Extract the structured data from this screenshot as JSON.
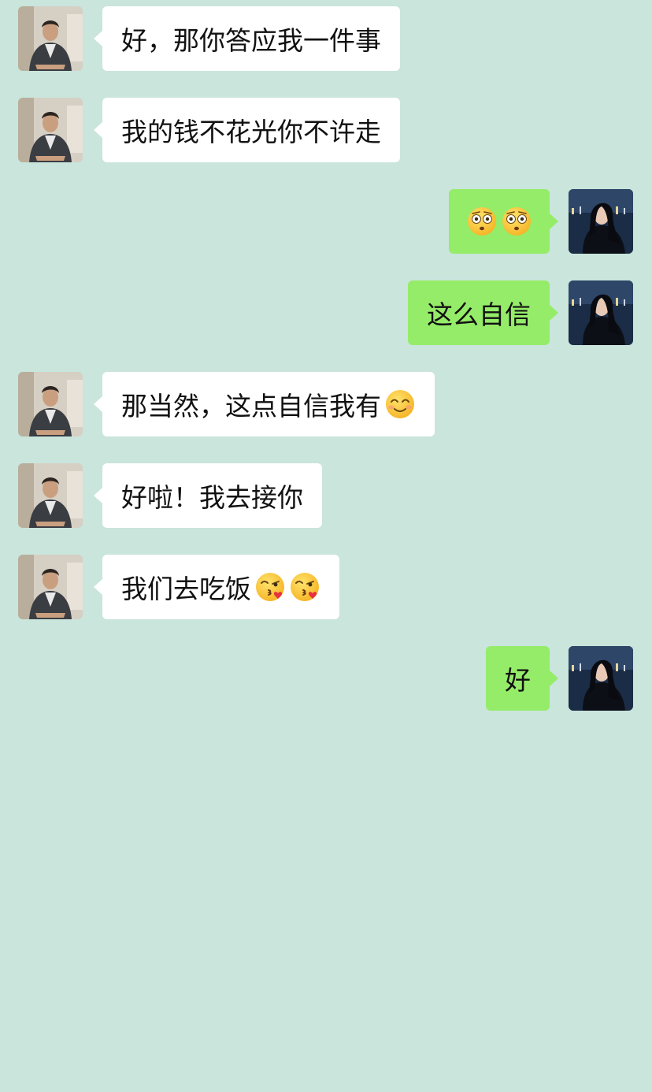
{
  "chat": {
    "messages": [
      {
        "side": "in",
        "text": "好，那你答应我一件事",
        "emojis": []
      },
      {
        "side": "in",
        "text": "我的钱不花光你不许走",
        "emojis": []
      },
      {
        "side": "out",
        "text": "",
        "emojis": [
          "flushed-face-icon",
          "flushed-face-icon"
        ]
      },
      {
        "side": "out",
        "text": "这么自信",
        "emojis": []
      },
      {
        "side": "in",
        "text": "那当然，这点自信我有",
        "emojis": [
          "smiling-face-icon"
        ]
      },
      {
        "side": "in",
        "text": "好啦！我去接你",
        "emojis": []
      },
      {
        "side": "in",
        "text": "我们去吃饭",
        "emojis": [
          "face-blowing-kiss-icon",
          "face-blowing-kiss-icon"
        ]
      },
      {
        "side": "out",
        "text": "好",
        "emojis": []
      }
    ]
  },
  "colors": {
    "background": "#c9e5dc",
    "incoming_bubble": "#ffffff",
    "outgoing_bubble": "#95ec69"
  }
}
